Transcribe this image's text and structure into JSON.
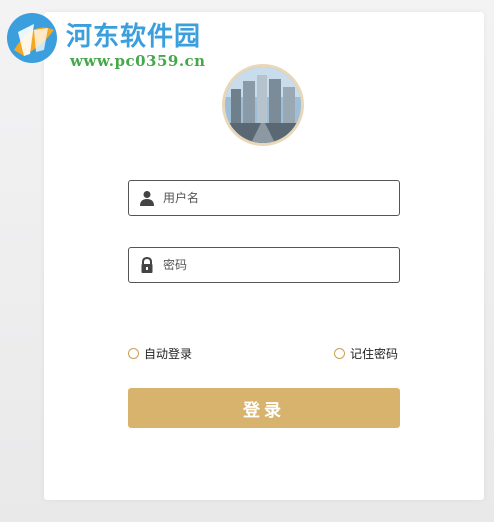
{
  "watermark": {
    "title": "河东软件园",
    "url": "www.pc0359.cn"
  },
  "avatar": {
    "icon": "city-photo-avatar"
  },
  "form": {
    "username": {
      "placeholder": "用户名",
      "value": "",
      "icon": "user-icon"
    },
    "password": {
      "placeholder": "密码",
      "value": "",
      "icon": "lock-icon"
    },
    "auto_login": {
      "label": "自动登录",
      "checked": false
    },
    "remember_password": {
      "label": "记住密码",
      "checked": false
    },
    "submit_label": "登录"
  },
  "colors": {
    "accent": "#d8b36e",
    "watermark_blue": "#3a9fdc",
    "watermark_green": "#45a84a",
    "checkbox_border": "#c9a24e"
  }
}
